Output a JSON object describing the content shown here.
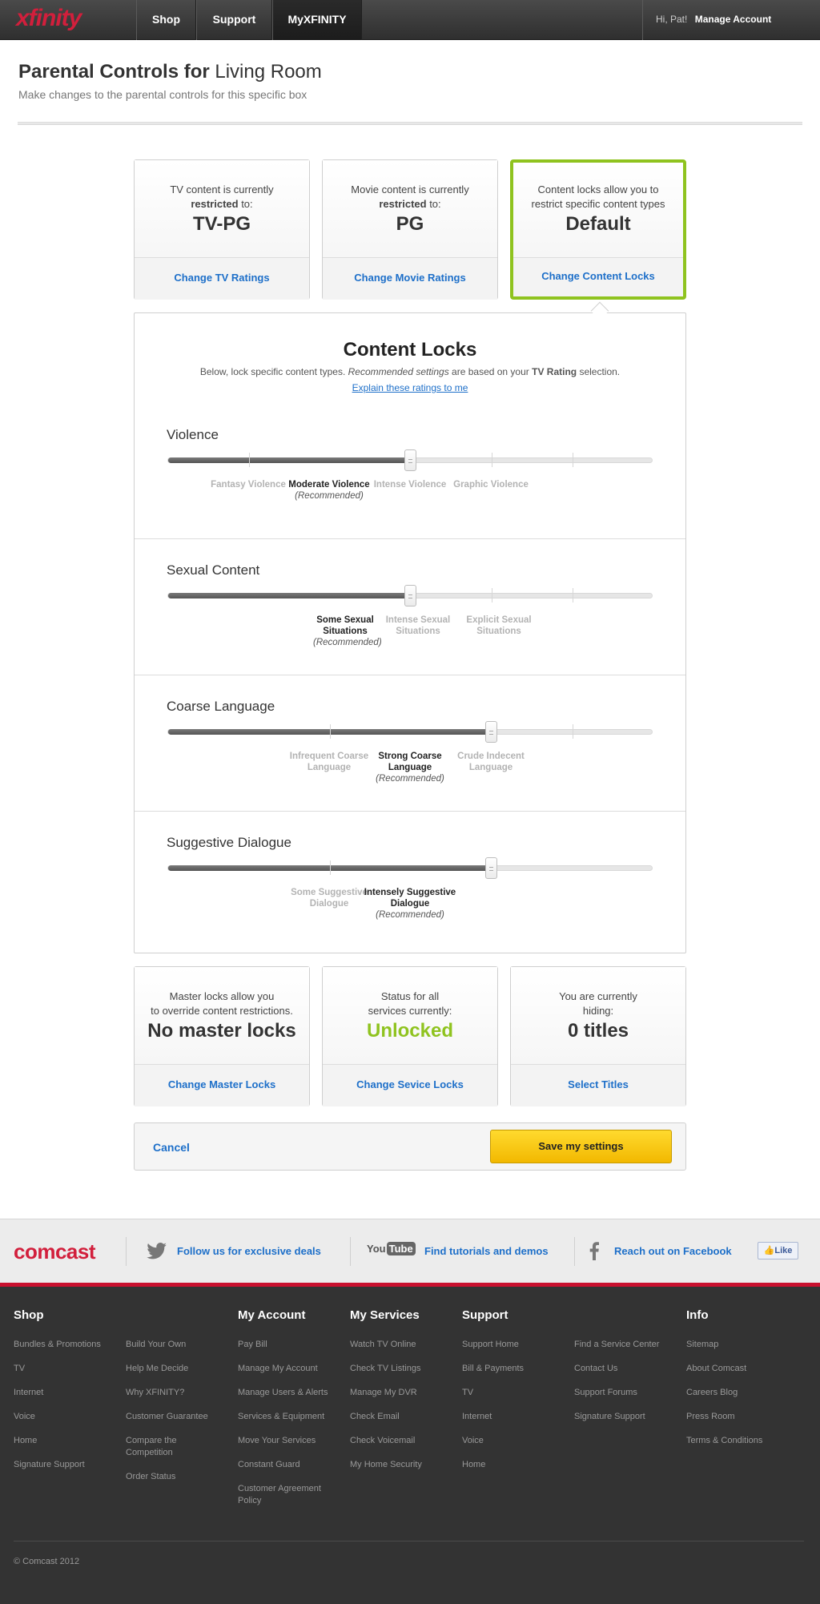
{
  "nav": {
    "logo": "xfinity",
    "items": [
      "Shop",
      "Support",
      "MyXFINITY"
    ],
    "greeting": "Hi, Pat!",
    "manage": "Manage Account"
  },
  "header": {
    "title_bold": "Parental Controls for",
    "title_rest": "Living Room",
    "subtitle": "Make changes to the parental controls for this specific box"
  },
  "summary_cards": [
    {
      "line1": "TV content is currently",
      "line2_bold": "restricted",
      "line2_rest": " to:",
      "value": "TV-PG",
      "action": "Change TV Ratings"
    },
    {
      "line1": "Movie content is currently",
      "line2_bold": "restricted",
      "line2_rest": " to:",
      "value": "PG",
      "action": "Change Movie Ratings"
    },
    {
      "line1": "Content locks allow you to",
      "line2": "restrict specific content types",
      "value": "Default",
      "action": "Change Content Locks"
    }
  ],
  "content_locks": {
    "title": "Content Locks",
    "desc_a": "Below, lock specific content types. ",
    "desc_i": "Recommended settings",
    "desc_b": " are based on your ",
    "desc_bold": "TV Rating",
    "desc_c": " selection.",
    "explain_link": "Explain these ratings to me",
    "recommended_label": "(Recommended)",
    "sections": [
      {
        "title": "Violence",
        "selected_fraction": 0.5,
        "levels": [
          "Fantasy Violence",
          "Moderate Violence",
          "Intense Violence",
          "Graphic Violence"
        ],
        "selected": "Moderate Violence"
      },
      {
        "title": "Sexual Content",
        "selected_fraction": 0.5,
        "levels": [
          "Some Sexual Situations",
          "Intense Sexual Situations",
          "Explicit Sexual Situations"
        ],
        "selected": "Some Sexual Situations"
      },
      {
        "title": "Coarse Language",
        "selected_fraction": 0.67,
        "levels": [
          "Infrequent Coarse Language",
          "Strong Coarse Language",
          "Crude Indecent Language"
        ],
        "selected": "Strong Coarse Language"
      },
      {
        "title": "Suggestive Dialogue",
        "selected_fraction": 0.67,
        "levels": [
          "Some Suggestive Dialogue",
          "Intensely Suggestive Dialogue"
        ],
        "selected": "Intensely Suggestive Dialogue"
      }
    ]
  },
  "lock_cards": [
    {
      "line1": "Master locks allow you",
      "line2": "to override content restrictions.",
      "value": "No master locks",
      "action": "Change Master Locks"
    },
    {
      "line1": "Status for all",
      "line2": "services currently:",
      "value": "Unlocked",
      "action": "Change Sevice Locks"
    },
    {
      "line1": "You are currently",
      "line2": "hiding:",
      "value": "0 titles",
      "action": "Select Titles"
    }
  ],
  "actions": {
    "cancel": "Cancel",
    "save": "Save my settings"
  },
  "social": {
    "brand": "comcast",
    "twitter": "Follow us for exclusive deals",
    "youtube_a": "You",
    "youtube_b": "Tube",
    "youtube": "Find tutorials and demos",
    "facebook": "Reach out on Facebook",
    "like": "Like"
  },
  "footer": {
    "columns": [
      {
        "heading": "Shop",
        "links": [
          "Bundles & Promotions",
          "TV",
          "Internet",
          "Voice",
          "Home",
          "Signature Support"
        ]
      },
      {
        "heading": "",
        "links": [
          "Build Your Own",
          "Help Me Decide",
          "Why XFINITY?",
          "Customer Guarantee",
          "Compare the Competition",
          "Order Status"
        ]
      },
      {
        "heading": "My Account",
        "links": [
          "Pay Bill",
          "Manage My Account",
          "Manage Users & Alerts",
          "Services & Equipment",
          "Move Your Services",
          "Constant Guard",
          "Customer Agreement Policy"
        ]
      },
      {
        "heading": "My Services",
        "links": [
          "Watch TV Online",
          "Check TV Listings",
          "Manage My DVR",
          "Check Email",
          "Check Voicemail",
          "My Home Security"
        ]
      },
      {
        "heading": "Support",
        "links": [
          "Support Home",
          "Bill & Payments",
          "TV",
          "Internet",
          "Voice",
          "Home"
        ]
      },
      {
        "heading": "",
        "links": [
          "Find a Service Center",
          "Contact Us",
          "Support Forums",
          "Signature Support"
        ]
      },
      {
        "heading": "Info",
        "links": [
          "Sitemap",
          "About Comcast",
          "Careers Blog",
          "Press Room",
          "Terms & Conditions"
        ]
      }
    ],
    "copyright": "© Comcast 2012"
  },
  "colors": {
    "brand_red": "#d21f3c",
    "link_blue": "#1d6fc9",
    "active_green": "#8fc31f",
    "save_yellow": "#f2b800",
    "unlocked_green": "#8fc31f"
  }
}
